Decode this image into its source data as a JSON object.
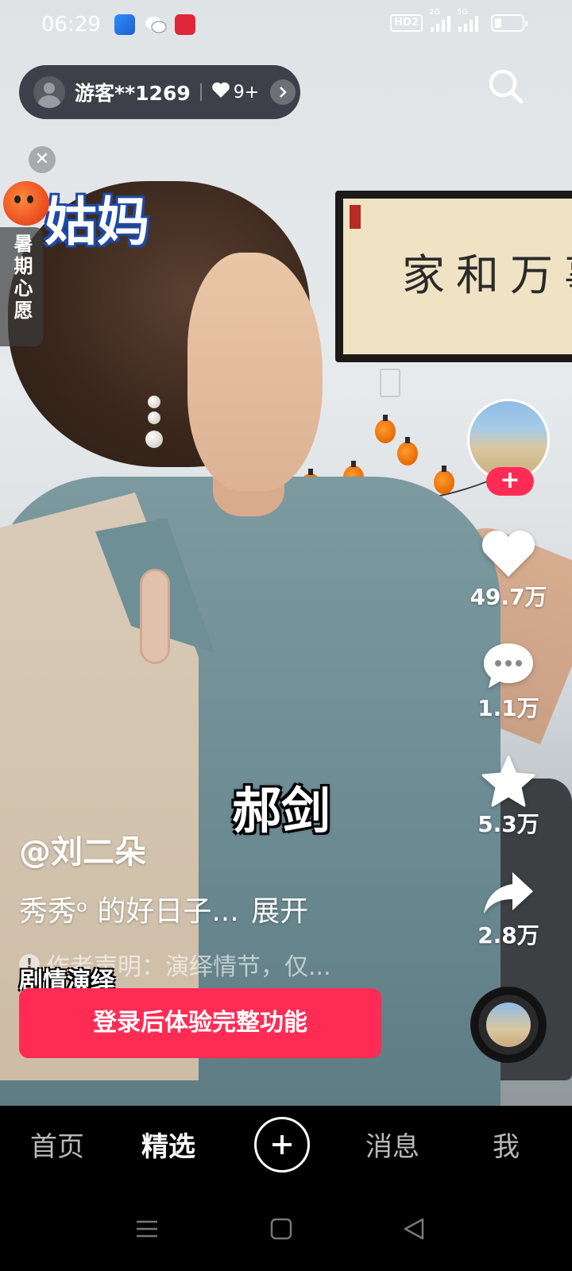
{
  "status_bar": {
    "time": "06:29",
    "network_badge": "HD2",
    "signal_1_label": "2G",
    "signal_2_label": "5G"
  },
  "guest": {
    "name": "游客**1269",
    "likes_count": "9+"
  },
  "promo": {
    "label": "暑期心愿"
  },
  "video": {
    "overlay_partial_text": "姑妈",
    "subtitle": "郝剑",
    "wall_calligraphy": "家和万事兴"
  },
  "actions": {
    "likes": "49.7万",
    "comments": "1.1万",
    "favorites": "5.3万",
    "shares": "2.8万"
  },
  "caption": {
    "author": "@刘二朵",
    "text": "秀秀ᵒ 的好日子...",
    "expand": "展开",
    "declaration": "作者声明：演绎情节，仅...",
    "tag": "剧情演绎"
  },
  "login_button": "登录后体验完整功能",
  "bottom_nav": {
    "items": [
      "首页",
      "精选",
      "消息",
      "我"
    ],
    "active": "精选"
  },
  "colors": {
    "accent": "#fe2c55",
    "nav_bg": "#000000"
  },
  "icons": [
    "search-icon",
    "heart-icon",
    "comment-icon",
    "star-icon",
    "share-icon",
    "plus-icon",
    "close-icon",
    "chevron-right-icon"
  ]
}
